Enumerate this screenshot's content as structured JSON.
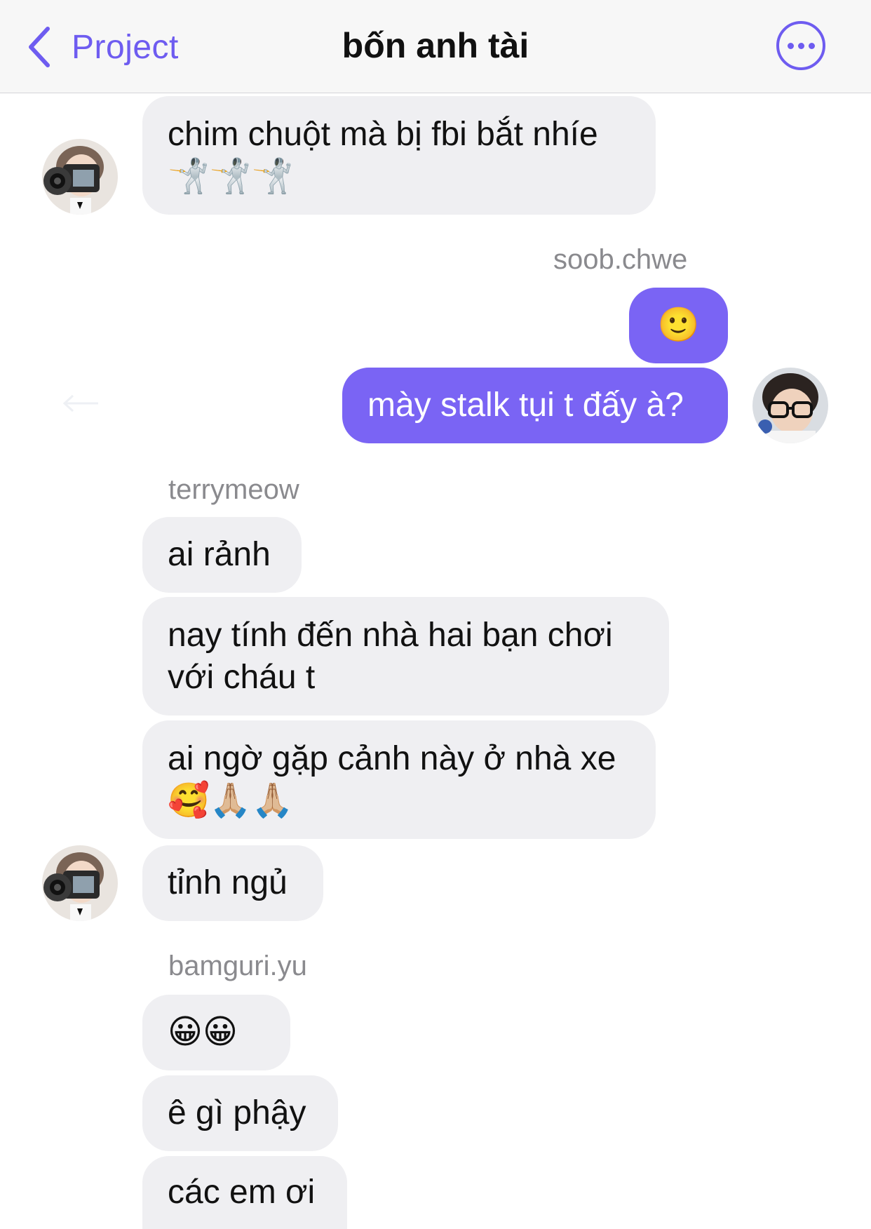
{
  "header": {
    "back_label": "Project",
    "title": "bốn anh tài",
    "more_icon": "ellipsis-circle-icon"
  },
  "colors": {
    "accent": "#6e5cf0",
    "outgoing_bubble": "#7a64f4",
    "incoming_bubble": "#efeff2",
    "sender_name": "#8a8a8e"
  },
  "messages": {
    "m1": "chim chuột mà bị fbi bắt nhíe\n🤺🤺🤺",
    "sender_soob": "soob.chwe",
    "m2": "🙂",
    "m3": "mày stalk tụi t đấy à?",
    "sender_terry": "terrymeow",
    "m4": "ai rảnh",
    "m5": "nay tính đến nhà hai bạn chơi\nvới cháu t",
    "m6": "ai ngờ gặp cảnh này ở nhà xe\n🥰🙏🏼🙏🏼",
    "m7": "tỉnh ngủ",
    "sender_bamguri": "bamguri.yu",
    "m8": "😀😀",
    "m9": "ê gì phậy",
    "m10": "các em ơi"
  }
}
